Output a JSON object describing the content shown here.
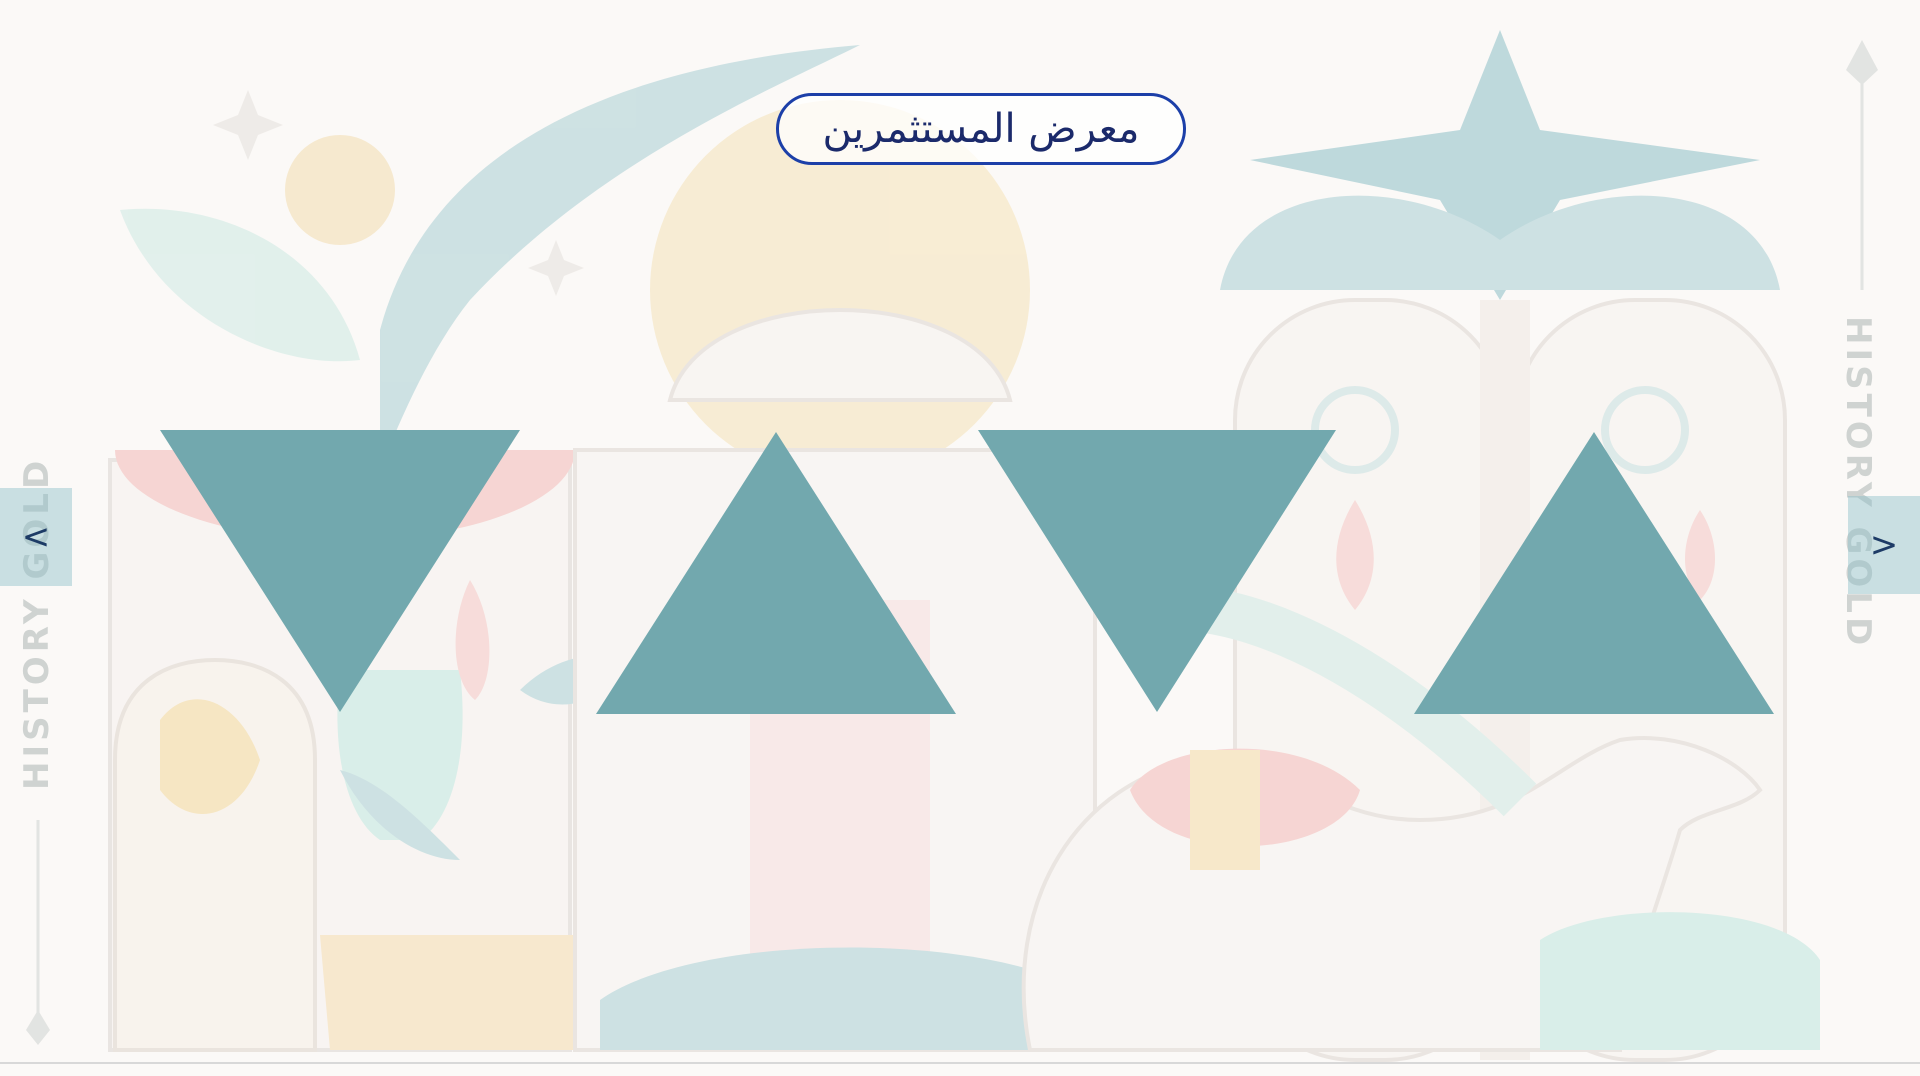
{
  "header": {
    "title": "معرض المستثمرين"
  },
  "navigation": {
    "prev_label": "<",
    "next_label": ">"
  },
  "decorations": {
    "left_side_text": "HISTORY GOLD",
    "right_side_text": "HISTORY GOLD"
  },
  "gallery": {
    "items": [
      {
        "shape": "triangle-down",
        "color": "#72a8ae"
      },
      {
        "shape": "triangle-up",
        "color": "#72a8ae"
      },
      {
        "shape": "triangle-down",
        "color": "#72a8ae"
      },
      {
        "shape": "triangle-up",
        "color": "#72a8ae"
      }
    ]
  },
  "colors": {
    "accent": "#72a8ae",
    "title_border": "#1c3fa8",
    "title_text": "#1b2a6b"
  }
}
